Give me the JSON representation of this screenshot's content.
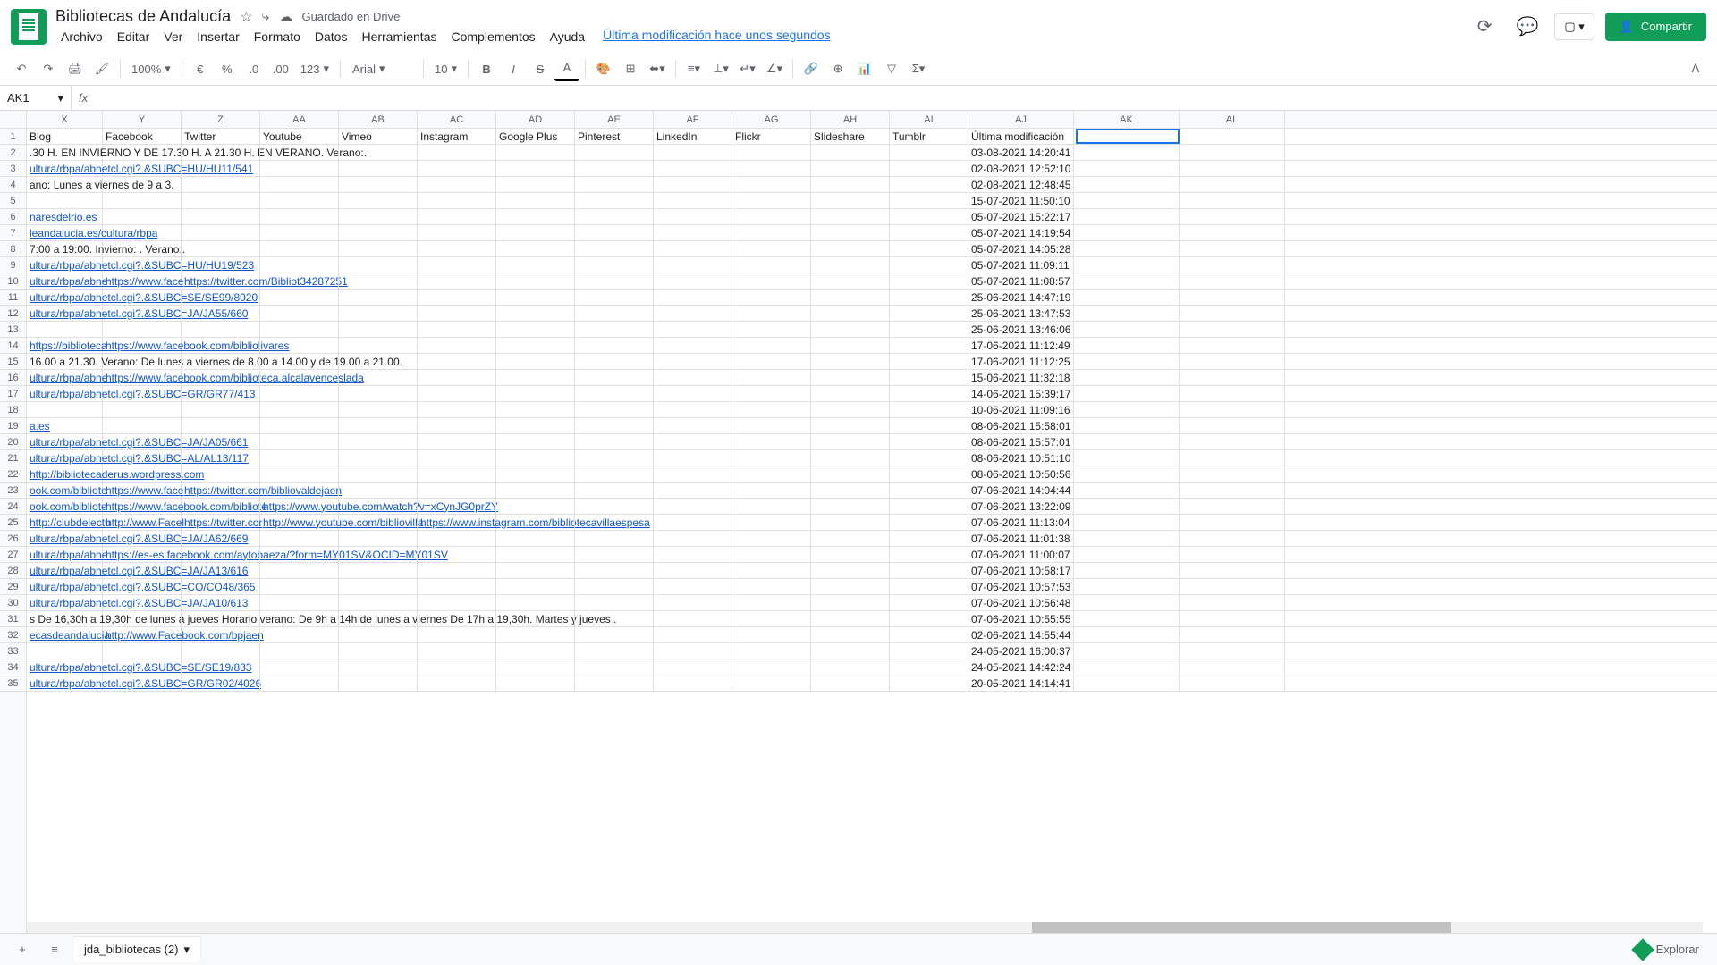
{
  "doc": {
    "title": "Bibliotecas de Andalucía",
    "save_status": "Guardado en Drive",
    "last_edit": "Última modificación hace unos segundos"
  },
  "menu": {
    "file": "Archivo",
    "edit": "Editar",
    "view": "Ver",
    "insert": "Insertar",
    "format": "Formato",
    "data": "Datos",
    "tools": "Herramientas",
    "addons": "Complementos",
    "help": "Ayuda"
  },
  "share": {
    "label": "Compartir"
  },
  "toolbar": {
    "zoom": "100%",
    "currency": "€",
    "percent": "%",
    "dec_dec": ".0",
    "dec_inc": ".00",
    "more_fmt": "123",
    "font": "Arial",
    "size": "10"
  },
  "formula": {
    "cell_ref": "AK1",
    "fx": "fx"
  },
  "columns": [
    "X",
    "Y",
    "Z",
    "AA",
    "AB",
    "AC",
    "AD",
    "AE",
    "AF",
    "AG",
    "AH",
    "AI",
    "AJ",
    "AK",
    "AL"
  ],
  "headers": {
    "X": "Blog",
    "Y": "Facebook",
    "Z": "Twitter",
    "AA": "Youtube",
    "AB": "Vimeo",
    "AC": "Instagram",
    "AD": "Google Plus",
    "AE": "Pinterest",
    "AF": "LinkedIn",
    "AG": "Flickr",
    "AH": "Slideshare",
    "AI": "Tumblr",
    "AJ": "Última modificación"
  },
  "rows": [
    {
      "n": 2,
      "X": ".30 H. EN INVIERNO Y DE 17.30 H. A 21.30 H. EN VERANO. Verano:.",
      "AJ": "03-08-2021 14:20:41"
    },
    {
      "n": 3,
      "X": "ultura/rbpa/abnetcl.cgi?.&SUBC=HU/HU11/541",
      "Xl": true,
      "AJ": "02-08-2021 12:52:10"
    },
    {
      "n": 4,
      "X": "ano: Lunes a viernes de 9 a 3.",
      "AJ": "02-08-2021 12:48:45"
    },
    {
      "n": 5,
      "AJ": "15-07-2021 11:50:10"
    },
    {
      "n": 6,
      "X": "naresdelrio.es",
      "Xl": true,
      "AJ": "05-07-2021 15:22:17"
    },
    {
      "n": 7,
      "X": "leandalucia.es/cultura/rbpa",
      "Xl": true,
      "AJ": "05-07-2021 14:19:54"
    },
    {
      "n": 8,
      "X": "7:00 a 19:00. Invierno: . Verano:.",
      "AJ": "05-07-2021 14:05:28"
    },
    {
      "n": 9,
      "X": "ultura/rbpa/abnetcl.cgi?.&SUBC=HU/HU19/523",
      "Xl": true,
      "AJ": "05-07-2021 11:09:11"
    },
    {
      "n": 10,
      "X": "ultura/rbpa/abne",
      "Xl": true,
      "Y": "https://www.face",
      "Yl": true,
      "Z": "https://twitter.com/Bibliot34287251",
      "Zl": true,
      "AJ": "05-07-2021 11:08:57"
    },
    {
      "n": 11,
      "X": "ultura/rbpa/abnetcl.cgi?.&SUBC=SE/SE99/8020",
      "Xl": true,
      "AJ": "25-06-2021 14:47:19"
    },
    {
      "n": 12,
      "X": "ultura/rbpa/abnetcl.cgi?.&SUBC=JA/JA55/660",
      "Xl": true,
      "AJ": "25-06-2021 13:47:53"
    },
    {
      "n": 13,
      "AJ": "25-06-2021 13:46:06"
    },
    {
      "n": 14,
      "X": "https://biblioteca",
      "Xl": true,
      "Y": "https://www.facebook.com/bibliolivares",
      "Yl": true,
      "AJ": "17-06-2021 11:12:49"
    },
    {
      "n": 15,
      "X": "16.00 a 21.30. Verano: De lunes a viernes de 8.00 a 14.00 y de 19.00 a 21.00.",
      "AJ": "17-06-2021 11:12:25"
    },
    {
      "n": 16,
      "X": "ultura/rbpa/abne",
      "Xl": true,
      "Y": "https://www.facebook.com/biblioteca.alcalavenceslada",
      "Yl": true,
      "AJ": "15-06-2021 11:32:18"
    },
    {
      "n": 17,
      "X": "ultura/rbpa/abnetcl.cgi?.&SUBC=GR/GR77/413",
      "Xl": true,
      "AJ": "14-06-2021 15:39:17"
    },
    {
      "n": 18,
      "AJ": "10-06-2021 11:09:16"
    },
    {
      "n": 19,
      "X": "a.es",
      "Xl": true,
      "AJ": "08-06-2021 15:58:01"
    },
    {
      "n": 20,
      "X": "ultura/rbpa/abnetcl.cgi?.&SUBC=JA/JA05/661",
      "Xl": true,
      "AJ": "08-06-2021 15:57:01"
    },
    {
      "n": 21,
      "X": "ultura/rbpa/abnetcl.cgi?.&SUBC=AL/AL13/117",
      "Xl": true,
      "AJ": "08-06-2021 10:51:10"
    },
    {
      "n": 22,
      "X": "http://bibliotecaderus.wordpress.com",
      "Xl": true,
      "AJ": "08-06-2021 10:50:56"
    },
    {
      "n": 23,
      "X": "ook.com/bibliote",
      "Xl": true,
      "Y": "https://www.face",
      "Yl": true,
      "Z": "https://twitter.com/bibliovaldejaen",
      "Zl": true,
      "AJ": "07-06-2021 14:04:44"
    },
    {
      "n": 24,
      "X": "ook.com/bibliote",
      "Xl": true,
      "Y": "https://www.facebook.com/bibliote",
      "Yl": true,
      "AA": "https://www.youtube.com/watch?v=xCynJG0prZY",
      "AAl": true,
      "AJ": "07-06-2021 13:22:09"
    },
    {
      "n": 25,
      "X": "http://clubdelectu",
      "Xl": true,
      "Y": "http://www.Facel",
      "Yl": true,
      "Z": "https://twitter.cor",
      "Zl": true,
      "AA": "http://www.youtube.com/bibliovilla",
      "AAl": true,
      "AC": "https://www.instagram.com/bibliotecavillaespesa",
      "ACl": true,
      "AJ": "07-06-2021 11:13:04"
    },
    {
      "n": 26,
      "X": "ultura/rbpa/abnetcl.cgi?.&SUBC=JA/JA62/669",
      "Xl": true,
      "AJ": "07-06-2021 11:01:38"
    },
    {
      "n": 27,
      "X": "ultura/rbpa/abne",
      "Xl": true,
      "Y": "https://es-es.facebook.com/aytobaeza/?form=MY01SV&OCID=MY01SV",
      "Yl": true,
      "AJ": "07-06-2021 11:00:07"
    },
    {
      "n": 28,
      "X": "ultura/rbpa/abnetcl.cgi?.&SUBC=JA/JA13/616",
      "Xl": true,
      "AJ": "07-06-2021 10:58:17"
    },
    {
      "n": 29,
      "X": "ultura/rbpa/abnetcl.cgi?.&SUBC=CO/CO48/365",
      "Xl": true,
      "AJ": "07-06-2021 10:57:53"
    },
    {
      "n": 30,
      "X": "ultura/rbpa/abnetcl.cgi?.&SUBC=JA/JA10/613",
      "Xl": true,
      "AJ": "07-06-2021 10:56:48"
    },
    {
      "n": 31,
      "X": "s De 16,30h a 19,30h de lunes a jueves Horario verano: De 9h a 14h de lunes a viernes De 17h a 19,30h. Martes y jueves .",
      "AJ": "07-06-2021 10:55:55"
    },
    {
      "n": 32,
      "X": "ecasdeandalucia",
      "Xl": true,
      "Y": "http://www.Facebook.com/bpjaen",
      "Yl": true,
      "AJ": "02-06-2021 14:55:44"
    },
    {
      "n": 33,
      "AJ": "24-05-2021 16:00:37"
    },
    {
      "n": 34,
      "X": "ultura/rbpa/abnetcl.cgi?.&SUBC=SE/SE19/833",
      "Xl": true,
      "AJ": "24-05-2021 14:42:24"
    },
    {
      "n": 35,
      "X": "ultura/rbpa/abnetcl.cgi?.&SUBC=GR/GR02/4026",
      "Xl": true,
      "AJ": "20-05-2021 14:14:41"
    }
  ],
  "sheet_tab": "jda_bibliotecas (2)",
  "explore": "Explorar"
}
